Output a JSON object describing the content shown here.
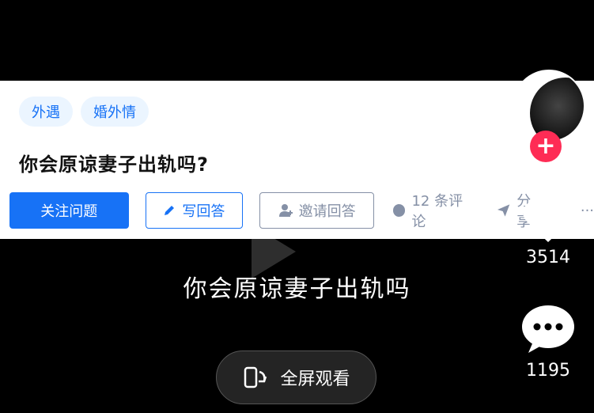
{
  "question_card": {
    "tags": [
      "外遇",
      "婚外情"
    ],
    "title": "你会原谅妻子出轨吗?",
    "follow_label": "关注问题",
    "write_label": "写回答",
    "invite_label": "邀请回答",
    "comments_label": "12 条评论",
    "share_label": "分享",
    "more_label": "···"
  },
  "video": {
    "caption": "你会原谅妻子出轨吗",
    "fullscreen_label": "全屏观看"
  },
  "rail": {
    "like_count": "3514",
    "comment_count": "1195",
    "follow_plus": "+"
  },
  "colors": {
    "brand_blue": "#1772f6",
    "tag_bg": "#ebf5ff",
    "muted": "#8590a6",
    "follow_red": "#fe2c55"
  }
}
